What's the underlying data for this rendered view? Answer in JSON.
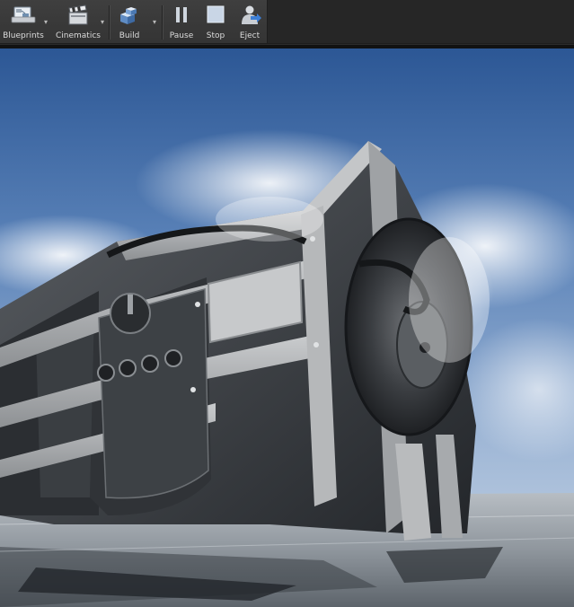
{
  "toolbar": {
    "buttons": [
      {
        "label": "Blueprints",
        "icon": "blueprints-icon"
      },
      {
        "label": "Cinematics",
        "icon": "clapperboard-icon"
      },
      {
        "label": "Build",
        "icon": "build-blocks-icon"
      },
      {
        "label": "Pause",
        "icon": "pause-icon"
      },
      {
        "label": "Stop",
        "icon": "stop-icon"
      },
      {
        "label": "Eject",
        "icon": "eject-icon"
      }
    ],
    "dropdown_glyph": "▾"
  },
  "colors": {
    "toolbar_bg": "#3a3a3a",
    "label_text": "#dcdcdc",
    "sky_top": "#2f5a9a",
    "sky_bottom": "#b8cbe3",
    "metal_dark": "#2a2c2f",
    "metal_light": "#a9abad"
  }
}
